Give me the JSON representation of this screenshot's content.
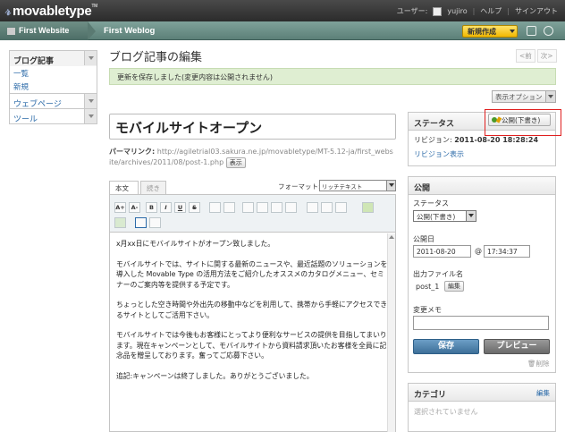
{
  "app": {
    "logo": "movabletype",
    "logo_sup": "TM",
    "user_label": "ユーザー:",
    "username": "yujiro",
    "help": "ヘルプ",
    "signout": "サインアウト"
  },
  "nav": {
    "website": "First Website",
    "blog": "First Weblog",
    "new_button": "新規作成"
  },
  "sidebar": {
    "blog_posts": {
      "title": "ブログ記事",
      "items": [
        "一覧",
        "新規"
      ]
    },
    "webpages": "ウェブページ",
    "tools": "ツール"
  },
  "page": {
    "title": "ブログ記事の編集",
    "prev": "<前",
    "next": "次>",
    "message": "更新を保存しました(変更内容は公開されません)",
    "display_options": "表示オプション"
  },
  "entry": {
    "title": "モバイルサイトオープン",
    "permalink_label": "パーマリンク:",
    "permalink_url": "http://agiletrial03.sakura.ne.jp/movabletype/MT-5.12-ja/first_website/archives/2011/08/post-1.php",
    "view_button": "表示",
    "tab_body": "本文",
    "tab_more": "続き",
    "format_label": "フォーマット:",
    "format_value": "リッチテキスト",
    "body": [
      "x月xx日にモバイルサイトがオープン致しました。",
      "モバイルサイトでは、サイトに関する最新のニュースや、最近話題のソリューションを導入した Movable Type の活用方法をご紹介したオススメのカタログメニュー、セミナーのご案内等を提供する予定です。",
      "ちょっとした空き時間や外出先の移動中などを利用して、携帯から手軽にアクセスできるサイトとしてご活用下さい。",
      "モバイルサイトでは今後もお客様にとってより便利なサービスの提供を目指してまいります。現在キャンペーンとして、モバイルサイトから資料請求頂いたお客様を全員に記念品を贈呈しております。奮ってご応募下さい。",
      "追記:キャンペーンは終了しました。ありがとうございました。"
    ]
  },
  "toolbar": {
    "buttons": [
      "A+",
      "A-",
      "B",
      "I",
      "U",
      "S",
      "link",
      "mail",
      "indent",
      "outdent",
      "ul",
      "ol",
      "left",
      "center",
      "right",
      "image",
      "file",
      "color",
      "source"
    ]
  },
  "status_panel": {
    "title": "ステータス",
    "publish_status": "公開(下書き)",
    "revision_label": "リビジョン:",
    "revision_value": "2011-08-20 18:28:24",
    "revision_link": "リビジョン表示"
  },
  "publish_panel": {
    "title": "公開",
    "status_label": "ステータス",
    "status_value": "公開(下書き)",
    "date_label": "公開日",
    "date_value": "2011-08-20",
    "at": "@",
    "time_value": "17:34:37",
    "filename_label": "出力ファイル名",
    "filename_value": "post_1",
    "edit_button": "編集",
    "memo_label": "変更メモ",
    "memo_value": "",
    "save": "保存",
    "preview": "プレビュー",
    "delete": "削除"
  },
  "category_panel": {
    "title": "カテゴリ",
    "edit": "編集",
    "empty": "選択されていません"
  }
}
